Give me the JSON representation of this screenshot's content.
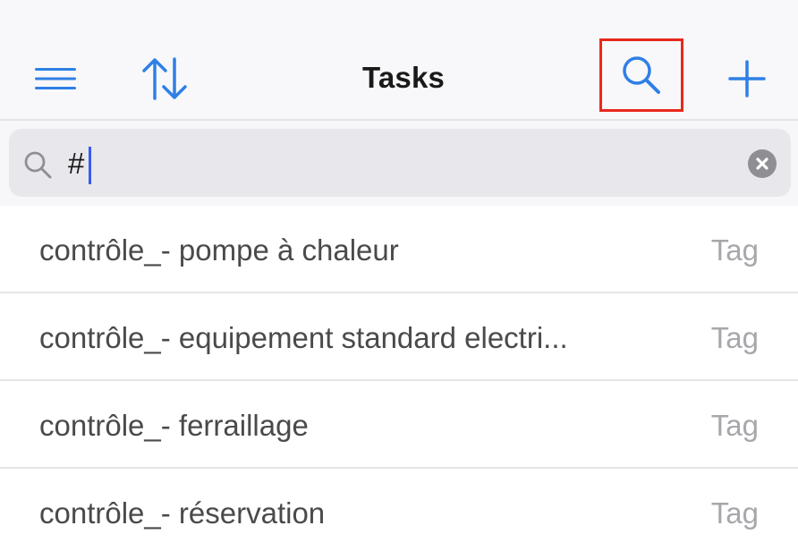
{
  "navbar": {
    "title": "Tasks",
    "accent_color": "#2f7fe6",
    "highlight_color": "#e8281c",
    "icons": {
      "menu": "hamburger-menu-icon",
      "sort": "sort-arrows-icon",
      "search": "search-icon",
      "add": "plus-icon"
    }
  },
  "search": {
    "value": "#",
    "icon": "search-icon",
    "clear_icon": "clear-circle-icon"
  },
  "tasks": [
    {
      "title": "contrôle_-  pompe à chaleur",
      "tag": "Tag"
    },
    {
      "title": "contrôle_- equipement standard electri...",
      "tag": "Tag"
    },
    {
      "title": "contrôle_- ferraillage",
      "tag": "Tag"
    },
    {
      "title": "contrôle_- réservation",
      "tag": "Tag"
    }
  ]
}
